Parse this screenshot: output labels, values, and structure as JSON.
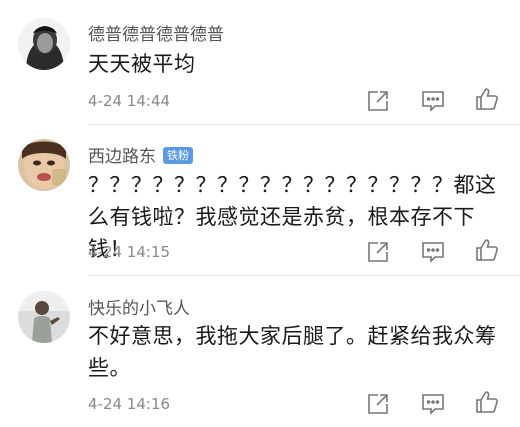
{
  "comments": [
    {
      "username": "德普德普德普德普",
      "badge": "",
      "text": "天天被平均",
      "time": "4-24 14:44"
    },
    {
      "username": "西边路东",
      "badge": "铁粉",
      "text": "？？？？？？？？？？？？？？？？？都这么有钱啦？我感觉还是赤贫，根本存不下钱！",
      "time": "4-24 14:15"
    },
    {
      "username": "快乐的小飞人",
      "badge": "",
      "text": "不好意思，我拖大家后腿了。赶紧给我众筹些。",
      "time": "4-24 14:16"
    }
  ],
  "icons": {
    "share": "share-icon",
    "reply": "comment-icon",
    "like": "thumbs-up-icon"
  },
  "colors": {
    "badge": "#5b9ae0",
    "meta_text": "#888888",
    "icon": "#777777"
  }
}
